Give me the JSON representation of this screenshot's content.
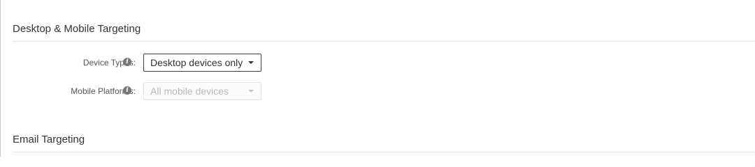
{
  "sections": {
    "device": {
      "title": "Desktop & Mobile Targeting",
      "device_types": {
        "label": "Device Types:",
        "value": "Desktop devices only"
      },
      "mobile_platforms": {
        "label": "Mobile Platforms:",
        "value": "All mobile devices",
        "disabled": true
      }
    },
    "email": {
      "title": "Email Targeting"
    }
  },
  "icons": {
    "info": "info-circle-icon",
    "dropdown": "caret-down-icon"
  },
  "colors": {
    "text": "#333333",
    "label": "#555555",
    "disabled_text": "#b8b8b8",
    "divider": "#e6e6e6"
  }
}
